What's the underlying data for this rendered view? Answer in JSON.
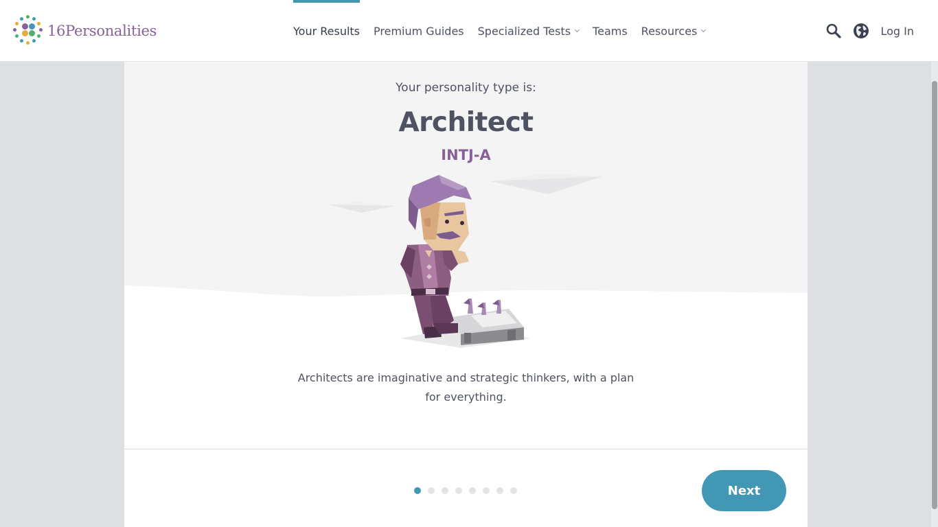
{
  "header": {
    "logo_text": "16Personalities",
    "nav": [
      {
        "label": "Your Results",
        "active": true,
        "dropdown": false
      },
      {
        "label": "Premium Guides",
        "active": false,
        "dropdown": false
      },
      {
        "label": "Specialized Tests",
        "active": false,
        "dropdown": true
      },
      {
        "label": "Teams",
        "active": false,
        "dropdown": false
      },
      {
        "label": "Resources",
        "active": false,
        "dropdown": true
      }
    ],
    "icons": [
      "search-icon",
      "globe-icon"
    ],
    "login_label": "Log In"
  },
  "result": {
    "intro": "Your personality type is:",
    "type_name": "Architect",
    "type_code": "INTJ-A",
    "description": "Architects are imaginative and strategic thinkers, with a plan for everything."
  },
  "pager": {
    "total_steps": 8,
    "current_step": 1,
    "next_label": "Next"
  },
  "colors": {
    "accent": "#4298b4",
    "analyst_purple": "#88619a",
    "text": "#4e5261"
  }
}
